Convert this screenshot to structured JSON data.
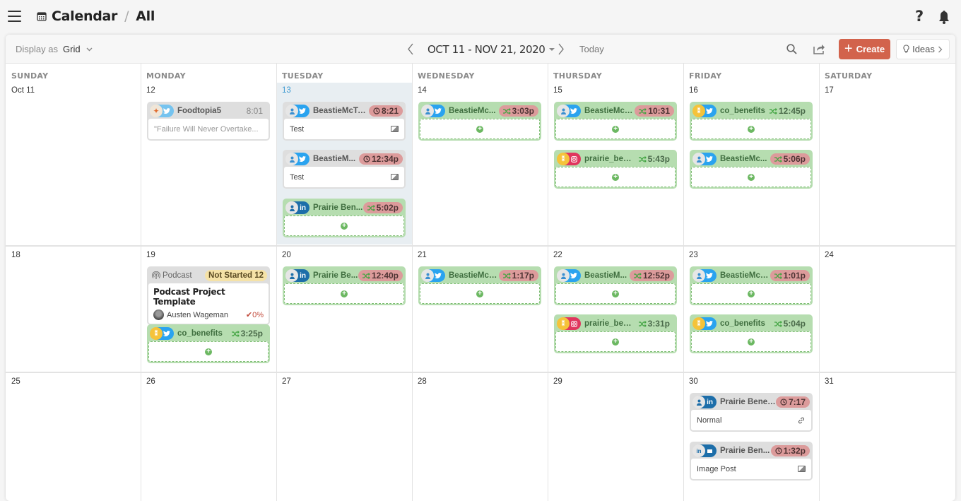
{
  "header": {
    "title": "Calendar",
    "separator": "/",
    "view": "All",
    "help_label": "?"
  },
  "toolbar": {
    "display_as_label": "Display as",
    "display_value": "Grid",
    "date_range": "OCT 11 - NOV 21, 2020",
    "today_label": "Today",
    "create_label": "Create",
    "ideas_label": "Ideas"
  },
  "colors": {
    "create_button": "#d2634c",
    "today_date": "#3f9bd3",
    "published_card": "#b6ddb0",
    "scheduled_card": "#dedede",
    "overdue_time": "#dc9b9b",
    "not_started_badge": "#f5e2a7"
  },
  "weekdays": [
    "SUNDAY",
    "MONDAY",
    "TUESDAY",
    "WEDNESDAY",
    "THURSDAY",
    "FRIDAY",
    "SATURDAY"
  ],
  "weeks": [
    {
      "days": [
        "Oct 11",
        "12",
        "13",
        "14",
        "15",
        "16",
        "17"
      ]
    },
    {
      "days": [
        "18",
        "19",
        "20",
        "21",
        "22",
        "23",
        "24"
      ]
    },
    {
      "days": [
        "25",
        "26",
        "27",
        "28",
        "29",
        "30",
        "31"
      ]
    }
  ],
  "today_day": "13",
  "events": {
    "mon12": {
      "account": "Foodtopia5",
      "network": "twitter",
      "time": "8:01",
      "body": "\"Failure Will Never Overtake..."
    },
    "tue13a": {
      "account": "BeastieMcTest",
      "network": "twitter",
      "time": "8:21",
      "time_icon": "clock-icon",
      "body": "Test",
      "attachment": "image-icon"
    },
    "tue13b": {
      "account": "BeastieM...",
      "network": "twitter",
      "time": "12:34p",
      "time_icon": "clock-icon",
      "body": "Test",
      "attachment": "image-icon"
    },
    "tue13c": {
      "account": "Prairie Ben...",
      "network": "linkedin",
      "time": "5:02p",
      "time_icon": "shuffle-icon"
    },
    "wed14": {
      "account": "BeastieMc...",
      "network": "twitter",
      "time": "3:03p",
      "time_icon": "shuffle-icon"
    },
    "thu15a": {
      "account": "BeastieMcT...",
      "network": "twitter",
      "time": "10:31",
      "time_icon": "shuffle-icon"
    },
    "thu15b": {
      "account": "prairie_ben...",
      "network": "instagram",
      "time": "5:43p",
      "time_icon": "shuffle-icon"
    },
    "fri16a": {
      "account": "co_benefits",
      "network": "twitter",
      "time": "12:45p",
      "time_icon": "shuffle-icon"
    },
    "fri16b": {
      "account": "BeastieMc...",
      "network": "twitter",
      "time": "5:06p",
      "time_icon": "shuffle-icon"
    },
    "mon19a": {
      "type_label": "Podcast",
      "status": "Not Started",
      "count": "12",
      "title": "Podcast Project Template",
      "assignee": "Austen Wageman",
      "progress": "0%"
    },
    "mon19b": {
      "account": "co_benefits",
      "network": "twitter",
      "time": "3:25p",
      "time_icon": "shuffle-icon"
    },
    "tue20": {
      "account": "Prairie Be...",
      "network": "linkedin",
      "time": "12:40p",
      "time_icon": "shuffle-icon"
    },
    "wed21": {
      "account": "BeastieMcT...",
      "network": "twitter",
      "time": "1:17p",
      "time_icon": "shuffle-icon"
    },
    "thu22a": {
      "account": "BeastieM...",
      "network": "twitter",
      "time": "12:52p",
      "time_icon": "shuffle-icon"
    },
    "thu22b": {
      "account": "prairie_bene...",
      "network": "instagram",
      "time": "3:31p",
      "time_icon": "shuffle-icon"
    },
    "fri23a": {
      "account": "BeastieMcT...",
      "network": "twitter",
      "time": "1:01p",
      "time_icon": "shuffle-icon"
    },
    "fri23b": {
      "account": "co_benefits",
      "network": "twitter",
      "time": "5:04p",
      "time_icon": "shuffle-icon"
    },
    "fri30a": {
      "account": "Prairie Benef...",
      "network": "linkedin",
      "time": "7:17",
      "time_icon": "clock-icon",
      "body": "Normal",
      "attachment": "link-icon"
    },
    "fri30b": {
      "account": "Prairie Ben...",
      "network": "linkedin-page",
      "time": "1:32p",
      "time_icon": "clock-icon",
      "body": "Image Post",
      "attachment": "image-icon"
    }
  }
}
